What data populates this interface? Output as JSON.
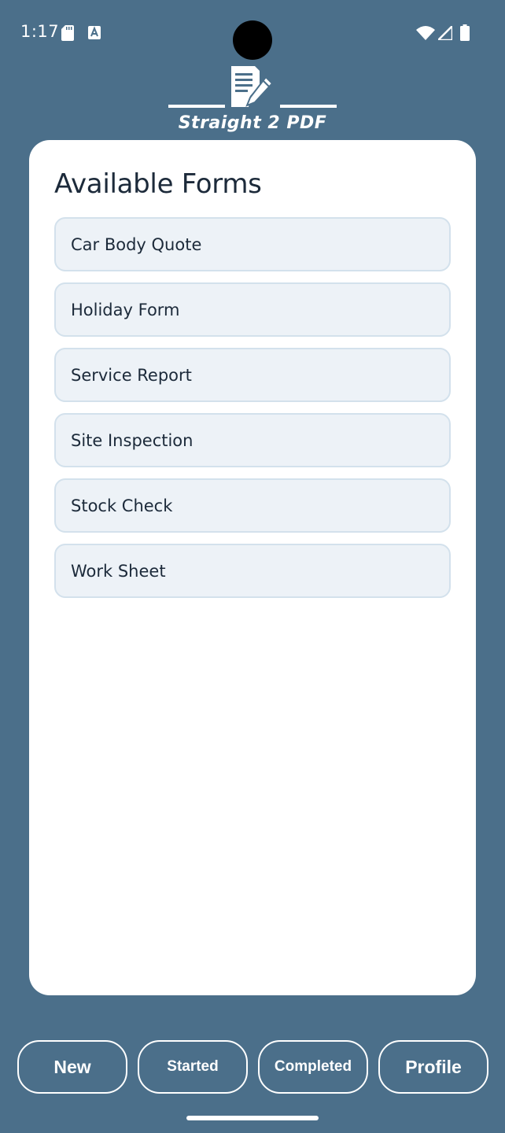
{
  "status_bar": {
    "time": "1:17",
    "icons": [
      "sd-card-icon",
      "accessibility-a-icon",
      "wifi-icon",
      "cell-signal-icon",
      "battery-icon"
    ]
  },
  "app": {
    "logo_text": "Straight 2 PDF",
    "logo_icon": "document-pen-icon"
  },
  "main": {
    "title": "Available Forms",
    "forms": [
      "Car Body Quote",
      "Holiday Form",
      "Service Report",
      "Site Inspection",
      "Stock Check",
      "Work Sheet"
    ]
  },
  "nav": {
    "new_label": "New",
    "started_label": "Started",
    "completed_label": "Completed",
    "profile_label": "Profile"
  },
  "colors": {
    "background": "#4b6f8a",
    "card": "#ffffff",
    "item_bg": "#edf2f7",
    "item_border": "#d3e1ec",
    "text": "#1c2a3a"
  }
}
